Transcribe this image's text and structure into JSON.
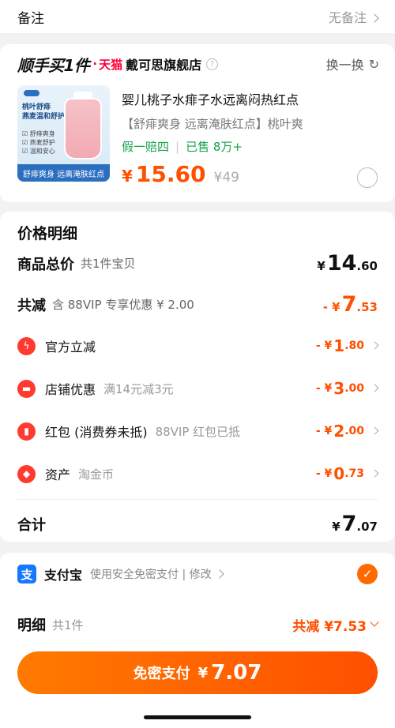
{
  "note": {
    "label": "备注",
    "value": "无备注"
  },
  "store": {
    "brand": "顺手买1件",
    "dot": "·",
    "platform": "天猫",
    "name": "戴可思旗舰店",
    "help_icon": "question-icon",
    "swap_label": "换一换",
    "refresh_icon": "refresh-icon"
  },
  "product": {
    "image_text": "桃叶舒痱\n燕麦温和舒护",
    "image_chips": "☑ 舒痱爽身\n☑ 燕麦舒护\n☑ 温和安心",
    "image_caption": "舒痱爽身 远离淹肤红点",
    "title": "婴儿桃子水痱子水远离闷热红点",
    "subtitle": "【舒痱爽身 远离淹肤红点】桃叶爽",
    "tag_guarantee": "假一赔四",
    "tag_sold": "已售 8万+",
    "price_symbol": "¥",
    "price": "15.60",
    "original_price": "¥49"
  },
  "detail": {
    "title": "价格明细",
    "total_goods": {
      "label": "商品总价",
      "desc": "共1件宝贝",
      "sym": "¥",
      "int": "14",
      "dec": ".60"
    },
    "reduce": {
      "label": "共减",
      "desc": "含 88VIP 专享优惠 ¥ 2.00",
      "sym": "- ¥",
      "int": "7",
      "dec": ".53"
    },
    "items": [
      {
        "icon": "lightning-icon",
        "glyph": "ϟ",
        "label": "官方立减",
        "desc": "",
        "sym": "- ¥",
        "int": "1",
        "dec": ".80"
      },
      {
        "icon": "store-coupon-icon",
        "glyph": "▬",
        "label": "店铺优惠",
        "desc": "满14元减3元",
        "sym": "- ¥",
        "int": "3",
        "dec": ".00"
      },
      {
        "icon": "red-packet-icon",
        "glyph": "▮",
        "label": "红包 (消费券未抵)",
        "desc": "88VIP 红包已抵",
        "sym": "- ¥",
        "int": "2",
        "dec": ".00"
      },
      {
        "icon": "tag-icon",
        "glyph": "◆",
        "label": "资产",
        "desc": "淘金币",
        "sym": "- ¥",
        "int": "0",
        "dec": ".73"
      }
    ],
    "sum": {
      "label": "合计",
      "sym": "¥",
      "int": "7",
      "dec": ".07"
    }
  },
  "payment": {
    "icon": "alipay-icon",
    "glyph": "支",
    "name": "支付宝",
    "desc": "使用安全免密支付 | 修改",
    "checked_icon": "check-icon"
  },
  "bottom": {
    "label": "明细",
    "count": "共1件",
    "total": "共减 ¥7.53",
    "button_text": "免密支付",
    "button_sym": "¥",
    "button_amount": "7.07"
  },
  "colors": {
    "accent": "#ff5000",
    "alipay": "#1677ff",
    "tmall": "#ff0036"
  }
}
